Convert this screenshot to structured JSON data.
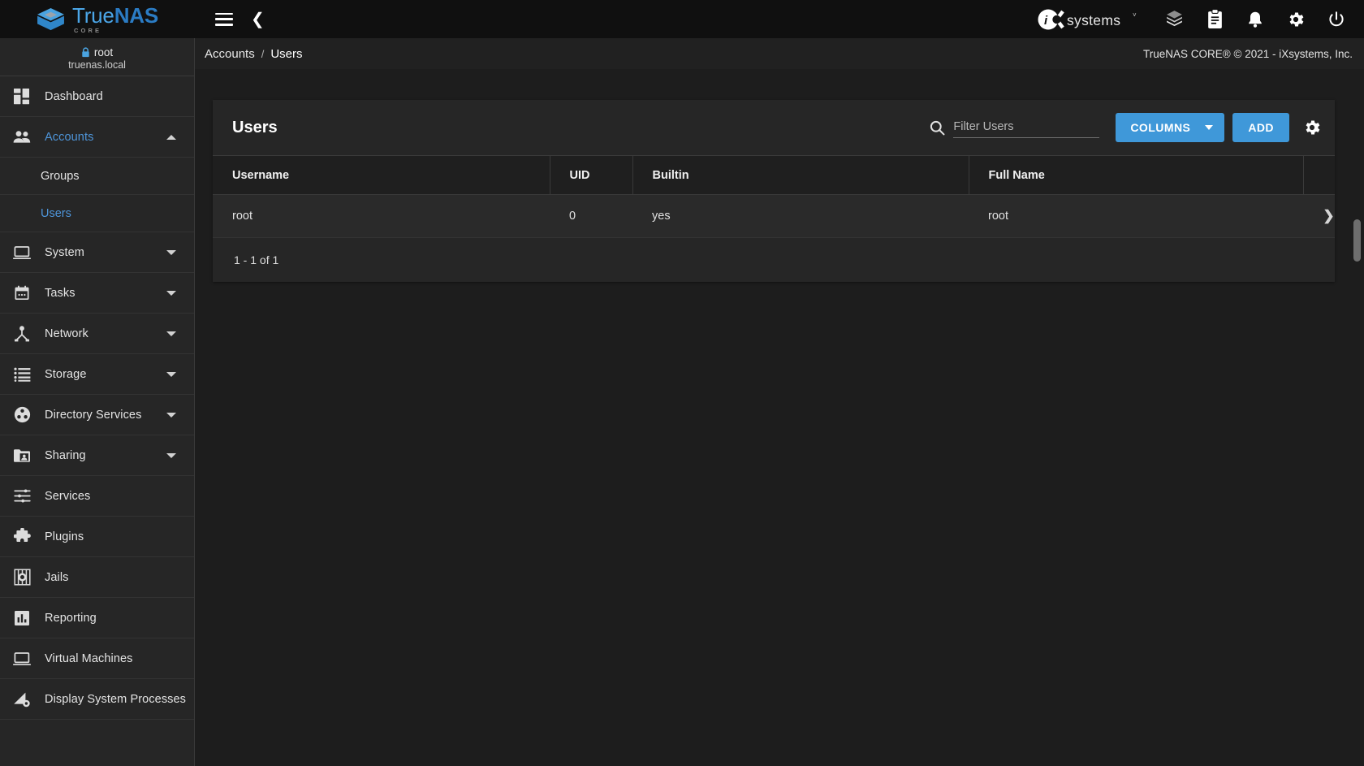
{
  "brand": {
    "product_main_a": "True",
    "product_main_b": "NAS",
    "product_sub": "CORE",
    "vendor": "iXsystems"
  },
  "topbar": {
    "menu_icon": "hamburger-menu-icon",
    "back_icon": "chevron-left-icon",
    "icons": [
      {
        "name": "cube-stack-icon",
        "label": "Jobs / Tasks"
      },
      {
        "name": "clipboard-icon",
        "label": "Task Manager"
      },
      {
        "name": "bell-icon",
        "label": "Alerts"
      },
      {
        "name": "gear-icon",
        "label": "Settings"
      },
      {
        "name": "power-icon",
        "label": "Power"
      }
    ]
  },
  "breadcrumb": {
    "items": [
      "Accounts",
      "Users"
    ],
    "separator": "/",
    "copyright": "TrueNAS CORE® © 2021 - iXsystems, Inc."
  },
  "sidebar": {
    "user": {
      "lock_icon": "lock-icon",
      "name": "root",
      "host": "truenas.local"
    },
    "items": [
      {
        "label": "Dashboard",
        "icon": "dashboard-icon",
        "expandable": false,
        "active": false
      },
      {
        "label": "Accounts",
        "icon": "people-icon",
        "expandable": true,
        "expanded": true,
        "active": true,
        "children": [
          {
            "label": "Groups",
            "active": false
          },
          {
            "label": "Users",
            "active": true
          }
        ]
      },
      {
        "label": "System",
        "icon": "monitor-icon",
        "expandable": true,
        "expanded": false,
        "active": false
      },
      {
        "label": "Tasks",
        "icon": "calendar-icon",
        "expandable": true,
        "expanded": false,
        "active": false
      },
      {
        "label": "Network",
        "icon": "network-icon",
        "expandable": true,
        "expanded": false,
        "active": false
      },
      {
        "label": "Storage",
        "icon": "storage-list-icon",
        "expandable": true,
        "expanded": false,
        "active": false
      },
      {
        "label": "Directory Services",
        "icon": "directory-services-icon",
        "expandable": true,
        "expanded": false,
        "active": false
      },
      {
        "label": "Sharing",
        "icon": "sharing-folder-icon",
        "expandable": true,
        "expanded": false,
        "active": false
      },
      {
        "label": "Services",
        "icon": "sliders-icon",
        "expandable": false,
        "active": false
      },
      {
        "label": "Plugins",
        "icon": "puzzle-icon",
        "expandable": false,
        "active": false
      },
      {
        "label": "Jails",
        "icon": "jail-icon",
        "expandable": false,
        "active": false
      },
      {
        "label": "Reporting",
        "icon": "bar-chart-icon",
        "expandable": false,
        "active": false
      },
      {
        "label": "Virtual Machines",
        "icon": "monitor-icon",
        "expandable": false,
        "active": false
      },
      {
        "label": "Display System Processes",
        "icon": "processes-icon",
        "expandable": false,
        "active": false
      }
    ]
  },
  "main": {
    "card_title": "Users",
    "search": {
      "icon": "search-icon",
      "placeholder": "Filter Users",
      "value": ""
    },
    "buttons": {
      "columns_label": "COLUMNS",
      "columns_caret_icon": "chevron-down-icon",
      "add_label": "ADD",
      "settings_icon": "gear-icon"
    },
    "table": {
      "columns": [
        "Username",
        "UID",
        "Builtin",
        "Full Name"
      ],
      "rows": [
        {
          "username": "root",
          "uid": "0",
          "builtin": "yes",
          "fullname": "root",
          "expand_icon": "chevron-right-icon"
        }
      ]
    },
    "footer": {
      "pagination": "1 - 1 of 1"
    }
  },
  "colors": {
    "accent": "#3f98d9",
    "link": "#4e95d9",
    "topbar_bg": "#101010",
    "sidebar_bg": "#262626",
    "content_bg": "#1d1d1d",
    "card_bg": "#262626",
    "table_header_bg": "#1f1f1f",
    "row_bg": "#2a2a2a"
  }
}
